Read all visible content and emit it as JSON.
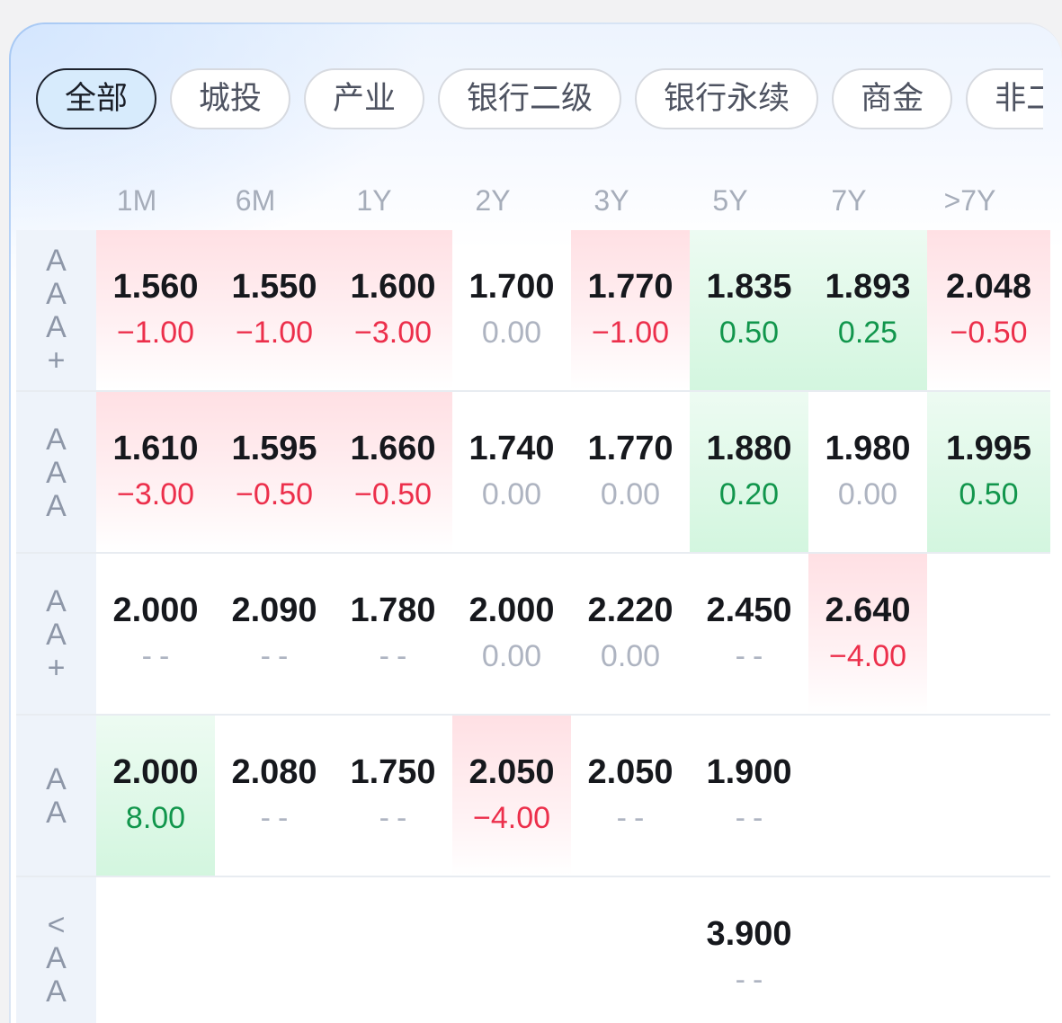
{
  "colors": {
    "negative": "#ec2f4b",
    "positive": "#11964c",
    "muted": "#aeb4c1",
    "negative_bg": "#ffe0e4",
    "positive_bg": "#d3f6df",
    "selected_chip": "#d7ebfc",
    "ink": "#16181d"
  },
  "filters": [
    {
      "label": "全部",
      "active": true
    },
    {
      "label": "城投",
      "active": false
    },
    {
      "label": "产业",
      "active": false
    },
    {
      "label": "银行二级",
      "active": false
    },
    {
      "label": "银行永续",
      "active": false
    },
    {
      "label": "商金",
      "active": false
    },
    {
      "label": "非二",
      "active": false
    }
  ],
  "table": {
    "columns": [
      "1M",
      "6M",
      "1Y",
      "2Y",
      "3Y",
      "5Y",
      "7Y",
      ">7Y"
    ],
    "rows": [
      {
        "rating": "AAA+",
        "cells": [
          {
            "yield": "1.560",
            "change": "−1.00"
          },
          {
            "yield": "1.550",
            "change": "−1.00"
          },
          {
            "yield": "1.600",
            "change": "−3.00"
          },
          {
            "yield": "1.700",
            "change": "0.00"
          },
          {
            "yield": "1.770",
            "change": "−1.00"
          },
          {
            "yield": "1.835",
            "change": "0.50"
          },
          {
            "yield": "1.893",
            "change": "0.25"
          },
          {
            "yield": "2.048",
            "change": "−0.50"
          }
        ]
      },
      {
        "rating": "AAA",
        "cells": [
          {
            "yield": "1.610",
            "change": "−3.00"
          },
          {
            "yield": "1.595",
            "change": "−0.50"
          },
          {
            "yield": "1.660",
            "change": "−0.50"
          },
          {
            "yield": "1.740",
            "change": "0.00"
          },
          {
            "yield": "1.770",
            "change": "0.00"
          },
          {
            "yield": "1.880",
            "change": "0.20"
          },
          {
            "yield": "1.980",
            "change": "0.00"
          },
          {
            "yield": "1.995",
            "change": "0.50"
          }
        ]
      },
      {
        "rating": "AA+",
        "cells": [
          {
            "yield": "2.000",
            "change": "--"
          },
          {
            "yield": "2.090",
            "change": "--"
          },
          {
            "yield": "1.780",
            "change": "--"
          },
          {
            "yield": "2.000",
            "change": "0.00"
          },
          {
            "yield": "2.220",
            "change": "0.00"
          },
          {
            "yield": "2.450",
            "change": "--"
          },
          {
            "yield": "2.640",
            "change": "−4.00"
          },
          null
        ]
      },
      {
        "rating": "AA",
        "cells": [
          {
            "yield": "2.000",
            "change": "8.00"
          },
          {
            "yield": "2.080",
            "change": "--"
          },
          {
            "yield": "1.750",
            "change": "--"
          },
          {
            "yield": "2.050",
            "change": "−4.00"
          },
          {
            "yield": "2.050",
            "change": "--"
          },
          {
            "yield": "1.900",
            "change": "--"
          },
          null,
          null
        ]
      },
      {
        "rating": "<AA",
        "cells": [
          null,
          null,
          null,
          null,
          null,
          {
            "yield": "3.900",
            "change": "--"
          },
          null,
          null
        ]
      }
    ]
  }
}
